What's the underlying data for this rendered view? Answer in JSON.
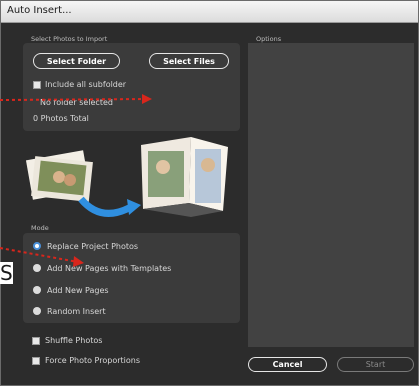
{
  "window": {
    "title": "Auto Insert..."
  },
  "import_section": {
    "label": "Select Photos to Import",
    "select_folder_label": "Select Folder",
    "select_files_label": "Select Files",
    "include_subfolder_label": "Include all subfolder",
    "folder_status": "No folder selected",
    "photos_total": "0 Photos Total"
  },
  "options_section": {
    "label": "Options"
  },
  "mode_section": {
    "label": "Mode",
    "modes": [
      {
        "label": "Replace Project Photos",
        "selected": true
      },
      {
        "label": "Add New Pages with Templates",
        "selected": false
      },
      {
        "label": "Add New Pages",
        "selected": false
      },
      {
        "label": "Random Insert",
        "selected": false
      }
    ]
  },
  "bottom": {
    "shuffle_label": "Shuffle Photos",
    "force_proportions_label": "Force Photo Proportions",
    "cancel_label": "Cancel",
    "start_label": "Start"
  },
  "annotation": {
    "partial_char": "S"
  },
  "colors": {
    "annotation_red": "#d9261c",
    "annotation_blue": "#2e7bd1",
    "accent": "#4a90d9"
  }
}
